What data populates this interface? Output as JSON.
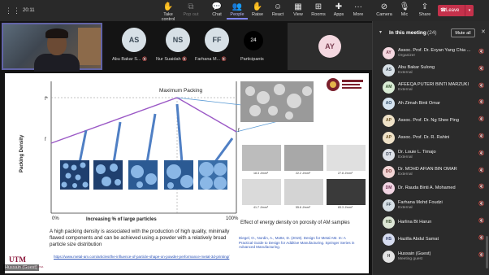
{
  "top_bar": {
    "timer": "20:11",
    "buttons": [
      {
        "label": "Take control",
        "icon": "take-control-icon",
        "state": "normal"
      },
      {
        "label": "Pop out",
        "icon": "pop-out-icon",
        "state": "dim"
      },
      {
        "label": "Chat",
        "icon": "chat-icon",
        "state": "normal"
      },
      {
        "label": "People",
        "icon": "people-icon",
        "state": "active"
      },
      {
        "label": "Raise",
        "icon": "raise-hand-icon",
        "state": "normal"
      },
      {
        "label": "React",
        "icon": "react-icon",
        "state": "normal"
      },
      {
        "label": "View",
        "icon": "view-icon",
        "state": "normal"
      },
      {
        "label": "Rooms",
        "icon": "rooms-icon",
        "state": "normal"
      },
      {
        "label": "Apps",
        "icon": "apps-icon",
        "state": "normal"
      },
      {
        "label": "More",
        "icon": "more-icon",
        "state": "normal"
      },
      {
        "label": "Camera",
        "icon": "camera-off-icon",
        "state": "normal"
      },
      {
        "label": "Mic",
        "icon": "mic-icon",
        "state": "normal"
      },
      {
        "label": "Share",
        "icon": "share-icon",
        "state": "normal"
      }
    ],
    "leave_label": "Leave",
    "leave_color": "#c4314b"
  },
  "tiles": [
    {
      "initials": "AS",
      "name": "Abu Bakar S..."
    },
    {
      "initials": "NS",
      "name": "Nur Suaidah"
    },
    {
      "initials": "FF",
      "name": "Farhana M..."
    }
  ],
  "participants_tile": {
    "count": "24",
    "label": "Participants"
  },
  "ay_tile": {
    "initials": "AY"
  },
  "presenter_label": "Hussain (Guest)",
  "slide": {
    "max_packing": "Maximum Packing",
    "f_star": "f*",
    "f_s": "f",
    "f_l": "f",
    "y_label": "Packing Density",
    "x_label": "Increasing % of large particles",
    "x_min": "0%",
    "x_max": "100%",
    "description": "A high packing density is associated with the production of high quality, minimally flawed components and can be achieved using a powder with a relatively broad particle size distribution",
    "link": "https://www.metal-am.com/articles/the-influence-of-particle-shape-on-powder-performance-metal-3d-printing/",
    "effect_caption": "Effect of energy density on porosity of AM samples",
    "reference": "Diegel, O., Nordin, A., Motte, D. (2019). Design for Metal AM. In: A Practical Guide to Design for Additive Manufacturing. Springer Series in Advanced Manufacturing.",
    "micro_labels": [
      "18.3 J/mm³",
      "22.2 J/mm³",
      "27.8 J/mm³",
      "41.7 J/mm³",
      "55.6 J/mm³",
      "83.3 J/mm³"
    ],
    "logo_text": "UTM",
    "logo_tagline": "UNIVERSITI TEKNOLOGI MALAYSIA"
  },
  "panel": {
    "title": "In this meeting",
    "count": "(24)",
    "mute_all": "Mute all",
    "participants": [
      {
        "initials": "AY",
        "name": "Assoc. Prof. Dr. Evyan Yang Chia ...",
        "sub": "Organizer",
        "color": "#f4d8e0",
        "fg": "#7a3e51"
      },
      {
        "initials": "AS",
        "name": "Abu Bakar Sulong",
        "sub": "External",
        "color": "#d7e0e6",
        "fg": "#3c4a56"
      },
      {
        "initials": "AM",
        "name": "AFEEQA PUTERI BINTI MARZUKI",
        "sub": "External",
        "color": "#d9ecd5",
        "fg": "#3b5a36"
      },
      {
        "initials": "AO",
        "name": "Ah Zimah Binti Omar",
        "sub": "",
        "color": "#d6e4f0",
        "fg": "#2f4c68"
      },
      {
        "initials": "AP",
        "name": "Assoc. Prof. Dr. Ng Shee Ping",
        "sub": "",
        "color": "#efe2c8",
        "fg": "#6b5325"
      },
      {
        "initials": "AP",
        "name": "Assoc. Prof. Dr. R. Rahini",
        "sub": "",
        "color": "#efe2c8",
        "fg": "#6b5325"
      },
      {
        "initials": "DT",
        "name": "Dr. Louie L. Timajo",
        "sub": "External",
        "color": "#dde1e8",
        "fg": "#3e4758"
      },
      {
        "initials": "DO",
        "name": "Dr. MOHD AFIAN BIN OMAR",
        "sub": "External",
        "color": "#f3d6d6",
        "fg": "#7a3535"
      },
      {
        "initials": "DM",
        "name": "Dr. Rauda Binti A. Mohamed",
        "sub": "",
        "color": "#f1d5e3",
        "fg": "#76395a"
      },
      {
        "initials": "FF",
        "name": "Farhana Mohd Foudzi",
        "sub": "External",
        "color": "#d7e0e6",
        "fg": "#3c4a56"
      },
      {
        "initials": "HB",
        "name": "Harlina Bt Harun",
        "sub": "",
        "color": "#dde6d6",
        "fg": "#45583a"
      },
      {
        "initials": "HS",
        "name": "Hazilla Abdul Samat",
        "sub": "",
        "color": "#d6dcef",
        "fg": "#36426c"
      },
      {
        "initials": "H",
        "name": "Hussain (Guest)",
        "sub": "Meeting guest",
        "color": "#e4e4e4",
        "fg": "#444"
      }
    ]
  }
}
